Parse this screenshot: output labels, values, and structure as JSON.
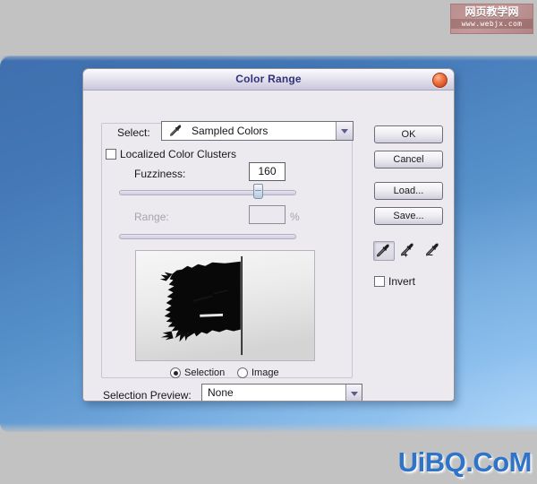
{
  "dialog": {
    "title": "Color Range",
    "close_icon": "close-circle-icon",
    "select": {
      "label": "Select:",
      "value": "Sampled Colors",
      "icon": "eyedropper-icon",
      "arrow_icon": "chevron-down-icon"
    },
    "localized_color_clusters": {
      "label": "Localized Color Clusters",
      "checked": false
    },
    "fuzziness": {
      "label": "Fuzziness:",
      "value": "160",
      "slider_percent": 76
    },
    "range": {
      "label": "Range:",
      "value": "",
      "unit": "%",
      "disabled": true,
      "slider_percent": 0
    },
    "preview": {
      "name": "color-range-preview",
      "description": "Black tattered flag on a pole against a light gray sky"
    },
    "preview_mode": {
      "options": [
        {
          "label": "Selection",
          "selected": true
        },
        {
          "label": "Image",
          "selected": false
        }
      ]
    },
    "buttons": {
      "ok": "OK",
      "cancel": "Cancel",
      "load": "Load...",
      "save": "Save..."
    },
    "tools": [
      {
        "name": "eyedropper-tool",
        "icon": "eyedropper-icon",
        "active": true
      },
      {
        "name": "eyedropper-add-tool",
        "icon": "eyedropper-plus-icon",
        "active": false
      },
      {
        "name": "eyedropper-subtract-tool",
        "icon": "eyedropper-minus-icon",
        "active": false
      }
    ],
    "invert": {
      "label": "Invert",
      "checked": false
    },
    "selection_preview": {
      "label": "Selection Preview:",
      "value": "None",
      "arrow_icon": "chevron-down-icon"
    }
  },
  "watermarks": {
    "top": {
      "chinese": "网页教学网",
      "url": "www.webjx.com"
    },
    "bottom": "UiBQ.CoM"
  },
  "colors": {
    "desktop_blue": "#4377b6",
    "title_text": "#32327a",
    "close_button": "#e06a38",
    "watermark_bottom": "#2f74c8"
  }
}
